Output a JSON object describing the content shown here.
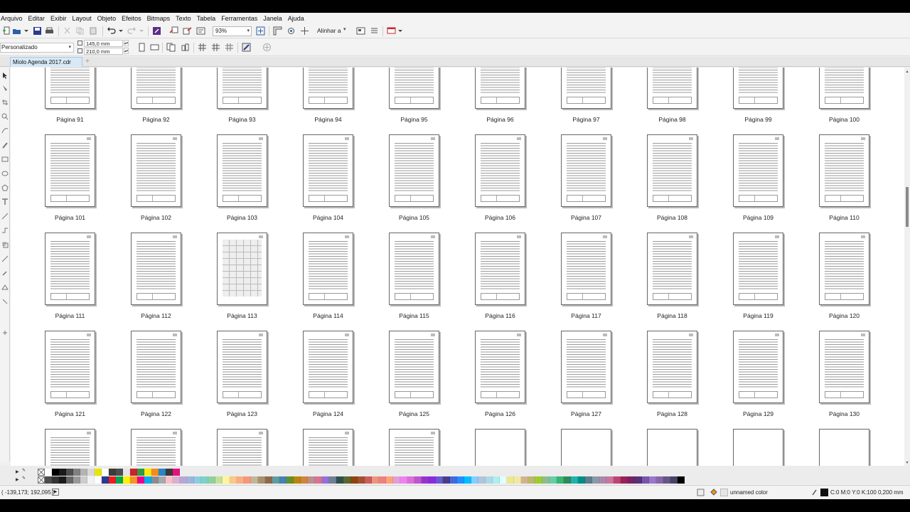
{
  "menu": [
    "Arquivo",
    "Editar",
    "Exibir",
    "Layout",
    "Objeto",
    "Efeitos",
    "Bitmaps",
    "Texto",
    "Tabela",
    "Ferramentas",
    "Janela",
    "Ajuda"
  ],
  "toolbar": {
    "zoom_value": "93%",
    "align_label": "Alinhar a"
  },
  "property_bar": {
    "preset": "Personalizado",
    "width": "145,0 mm",
    "height": "210,0 mm"
  },
  "tabs": {
    "document": "Miolo Agenda 2017.cdr",
    "add": "+"
  },
  "pages": [
    {
      "label": "Página 91",
      "type": "lined"
    },
    {
      "label": "Página 92",
      "type": "lined"
    },
    {
      "label": "Página 93",
      "type": "lined"
    },
    {
      "label": "Página 94",
      "type": "lined"
    },
    {
      "label": "Página 95",
      "type": "lined"
    },
    {
      "label": "Página 96",
      "type": "lined"
    },
    {
      "label": "Página 97",
      "type": "lined"
    },
    {
      "label": "Página 98",
      "type": "lined"
    },
    {
      "label": "Página 99",
      "type": "lined"
    },
    {
      "label": "Página 100",
      "type": "lined"
    },
    {
      "label": "Página 101",
      "type": "lined"
    },
    {
      "label": "Página 102",
      "type": "lined"
    },
    {
      "label": "Página 103",
      "type": "lined"
    },
    {
      "label": "Página 104",
      "type": "lined"
    },
    {
      "label": "Página 105",
      "type": "lined"
    },
    {
      "label": "Página 106",
      "type": "lined"
    },
    {
      "label": "Página 107",
      "type": "lined"
    },
    {
      "label": "Página 108",
      "type": "lined"
    },
    {
      "label": "Página 109",
      "type": "lined"
    },
    {
      "label": "Página 110",
      "type": "lined"
    },
    {
      "label": "Página 111",
      "type": "lined"
    },
    {
      "label": "Página 112",
      "type": "lined"
    },
    {
      "label": "Página 113",
      "type": "calendar"
    },
    {
      "label": "Página 114",
      "type": "lined"
    },
    {
      "label": "Página 115",
      "type": "lined"
    },
    {
      "label": "Página 116",
      "type": "lined"
    },
    {
      "label": "Página 117",
      "type": "lined"
    },
    {
      "label": "Página 118",
      "type": "lined"
    },
    {
      "label": "Página 119",
      "type": "lined"
    },
    {
      "label": "Página 120",
      "type": "lined"
    },
    {
      "label": "Página 121",
      "type": "lined"
    },
    {
      "label": "Página 122",
      "type": "lined"
    },
    {
      "label": "Página 123",
      "type": "lined"
    },
    {
      "label": "Página 124",
      "type": "lined"
    },
    {
      "label": "Página 125",
      "type": "lined"
    },
    {
      "label": "Página 126",
      "type": "lined"
    },
    {
      "label": "Página 127",
      "type": "lined"
    },
    {
      "label": "Página 128",
      "type": "lined"
    },
    {
      "label": "Página 129",
      "type": "lined"
    },
    {
      "label": "Página 130",
      "type": "lined"
    },
    {
      "label": "",
      "type": "lined"
    },
    {
      "label": "",
      "type": "lined"
    },
    {
      "label": "",
      "type": "lined"
    },
    {
      "label": "",
      "type": "lined"
    },
    {
      "label": "",
      "type": "lined"
    },
    {
      "label": "",
      "type": "blank"
    },
    {
      "label": "",
      "type": "blank"
    },
    {
      "label": "",
      "type": "blank"
    },
    {
      "label": "",
      "type": "blank"
    },
    {
      "label": "",
      "type": "blank"
    }
  ],
  "palette": {
    "row1": [
      "#ffffff",
      "#000000",
      "#1a1a1a",
      "#4d4d4d",
      "#808080",
      "#b3b3b3",
      "#d9d9d9",
      "#e6e600",
      "#ffffff",
      "#3c3c3c",
      "#4d4d4d",
      "#e6e6e6",
      "#cc2229",
      "#2e9a48",
      "#f7ea0c",
      "#f28c1a",
      "#2a84c6",
      "#3a3a3a",
      "#e4137c"
    ],
    "row2": [
      "#4d4d4d",
      "#333333",
      "#1a1a1a",
      "#666666",
      "#999999",
      "#cccccc",
      "#f2f2f2",
      "#ffffff",
      "#2b3990",
      "#ed1c24",
      "#00a651",
      "#fff200",
      "#f7941d",
      "#ec008c",
      "#00aeef",
      "#8b8c8e",
      "#a7a9ac",
      "#f9c0c8",
      "#d8b0d0",
      "#b9a6d6",
      "#9fb4dc",
      "#8ccbe6",
      "#7fd1c4",
      "#8fd19e",
      "#c4df9b",
      "#fff799",
      "#fdc68a",
      "#f9ad81",
      "#f69679",
      "#c2b59b",
      "#a88f6e",
      "#8c6b4a",
      "#5f9ea0",
      "#4682b4",
      "#6b8e23",
      "#b8860b",
      "#cd853f",
      "#bc8f8f",
      "#db7093",
      "#9370db",
      "#708090",
      "#2f4f4f",
      "#556b2f",
      "#8b4513",
      "#a0522d",
      "#cd5c5c",
      "#e9967a",
      "#f08080",
      "#ffa07a",
      "#dda0dd",
      "#ee82ee",
      "#da70d6",
      "#ba55d3",
      "#9932cc",
      "#8a2be2",
      "#6a5acd",
      "#483d8b",
      "#4169e1",
      "#1e90ff",
      "#00bfff",
      "#87cefa",
      "#b0c4de",
      "#add8e6",
      "#afeeee",
      "#e0ffff",
      "#f0e68c",
      "#eee8aa",
      "#d2b48c",
      "#bdb76b",
      "#9acd32",
      "#8fbc8f",
      "#66cdaa",
      "#3cb371",
      "#2e8b57",
      "#20b2aa",
      "#008b8b",
      "#5f7d8b",
      "#8899aa",
      "#aa88aa",
      "#cc7799",
      "#bb4477",
      "#992255",
      "#772266",
      "#553377",
      "#7755aa",
      "#9977cc",
      "#8866aa",
      "#665588",
      "#444466",
      "#000000"
    ]
  },
  "status": {
    "coords": "( -139,173; 192,095 )",
    "fill": "unnamed color",
    "outline": "C:0 M:0 Y:0 K:100  0,200 mm"
  }
}
